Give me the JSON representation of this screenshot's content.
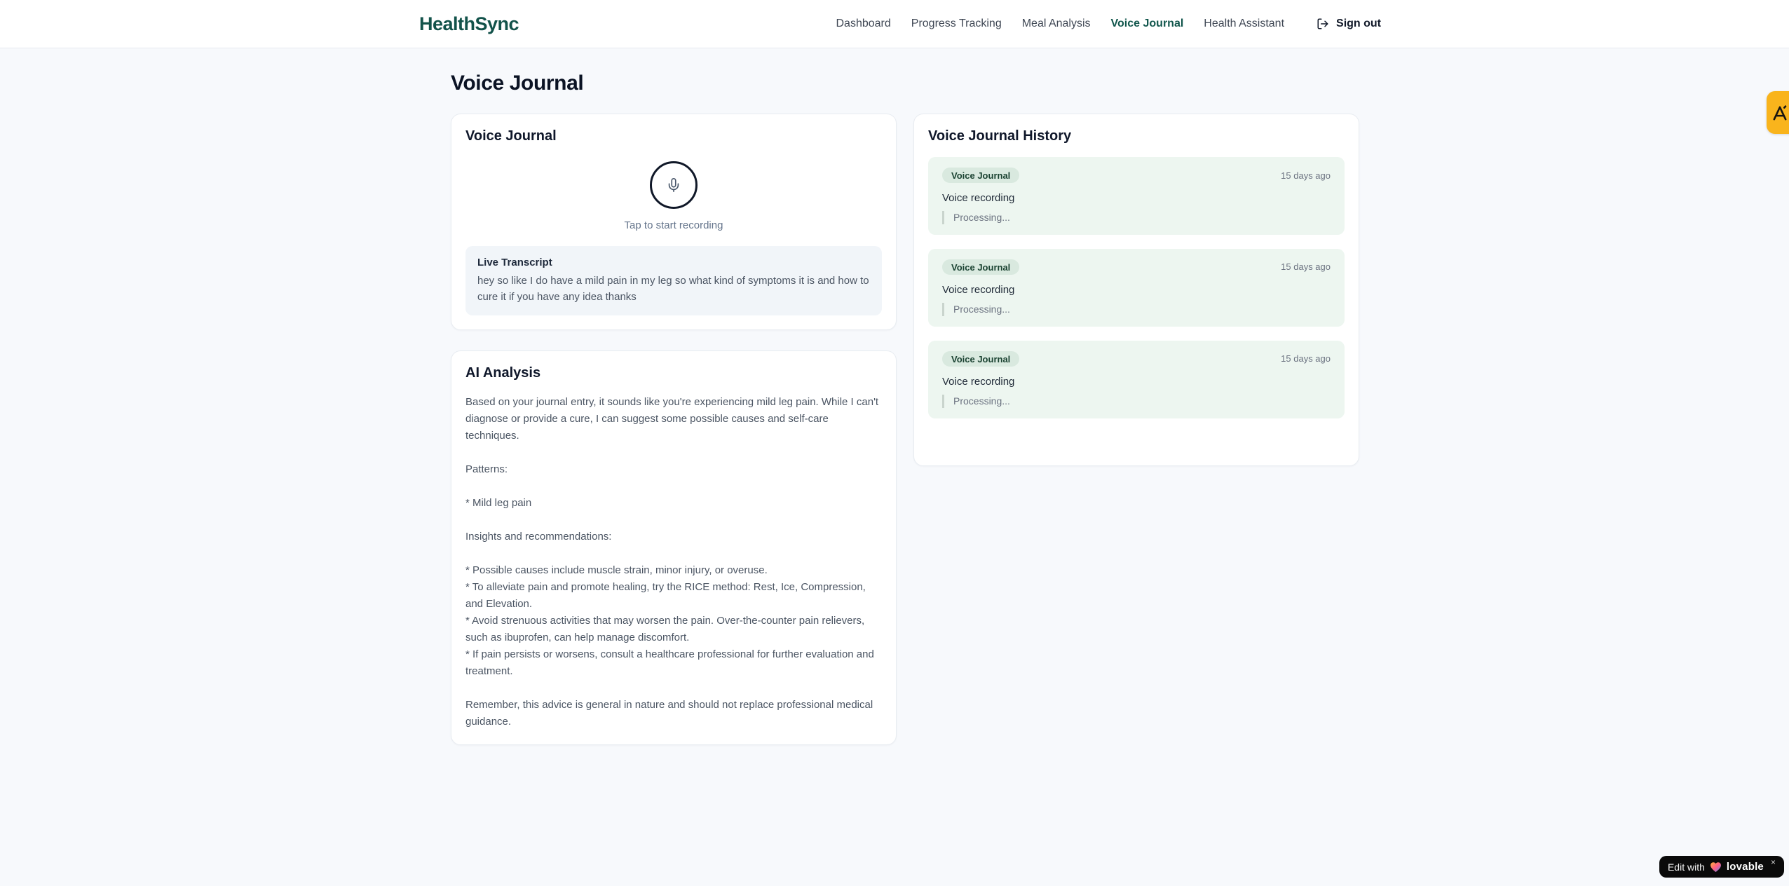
{
  "brand": {
    "name": "HealthSync"
  },
  "nav": {
    "items": [
      {
        "label": "Dashboard",
        "active": false
      },
      {
        "label": "Progress Tracking",
        "active": false
      },
      {
        "label": "Meal Analysis",
        "active": false
      },
      {
        "label": "Voice Journal",
        "active": true
      },
      {
        "label": "Health Assistant",
        "active": false
      }
    ],
    "sign_out_label": "Sign out"
  },
  "page": {
    "title": "Voice Journal"
  },
  "recorder_card": {
    "title": "Voice Journal",
    "tap_hint": "Tap to start recording",
    "transcript_title": "Live Transcript",
    "transcript_text": "hey so like I do have a mild pain in my leg so what kind of symptoms it is and how to cure it if you have any idea thanks"
  },
  "analysis_card": {
    "title": "AI Analysis",
    "body": "Based on your journal entry, it sounds like you're experiencing mild leg pain. While I can't diagnose or provide a cure, I can suggest some possible causes and self-care techniques.\n\nPatterns:\n\n* Mild leg pain\n\nInsights and recommendations:\n\n* Possible causes include muscle strain, minor injury, or overuse.\n* To alleviate pain and promote healing, try the RICE method: Rest, Ice, Compression, and Elevation.\n* Avoid strenuous activities that may worsen the pain. Over-the-counter pain relievers, such as ibuprofen, can help manage discomfort.\n* If pain persists or worsens, consult a healthcare professional for further evaluation and treatment.\n\nRemember, this advice is general in nature and should not replace professional medical guidance."
  },
  "history_card": {
    "title": "Voice Journal History",
    "entries": [
      {
        "badge": "Voice Journal",
        "time": "15 days ago",
        "title": "Voice recording",
        "status": "Processing..."
      },
      {
        "badge": "Voice Journal",
        "time": "15 days ago",
        "title": "Voice recording",
        "status": "Processing..."
      },
      {
        "badge": "Voice Journal",
        "time": "15 days ago",
        "title": "Voice recording",
        "status": "Processing..."
      }
    ]
  },
  "lovable_badge": {
    "prefix": "Edit with",
    "brand": "lovable",
    "close": "×"
  },
  "colors": {
    "brand_teal": "#12524a",
    "side_tab_amber": "#f9b41c",
    "history_entry_bg": "#edf6f0",
    "badge_bg": "#d9e9df",
    "badge_text": "#1b4332",
    "page_bg": "#f7f9fc"
  }
}
